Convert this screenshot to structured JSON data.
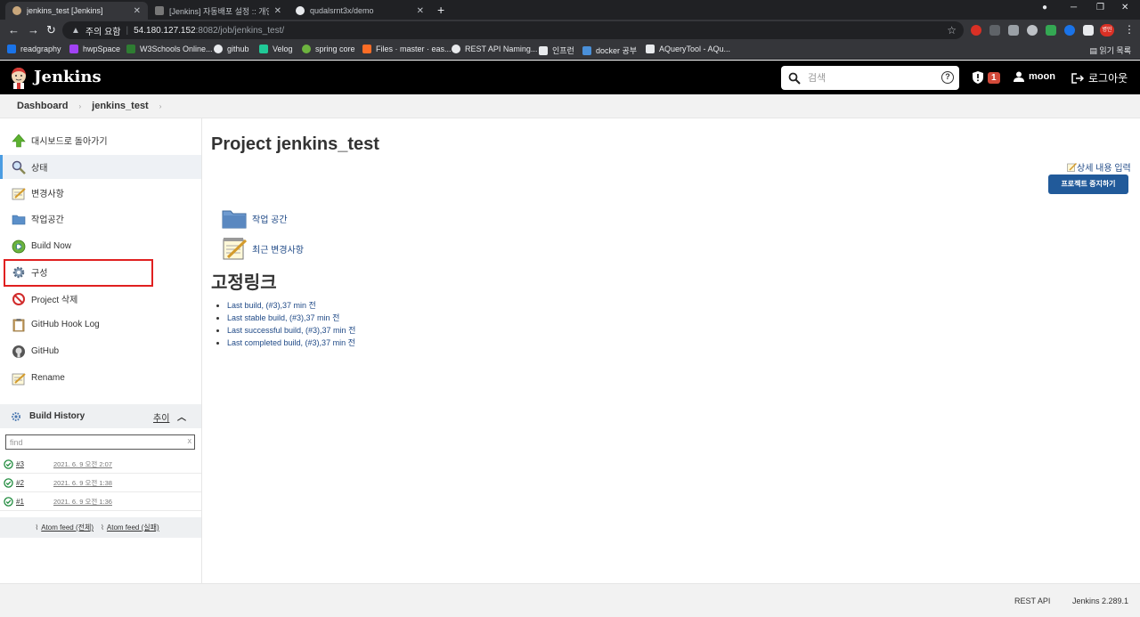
{
  "browser": {
    "tabs": [
      {
        "title": "jenkins_test [Jenkins]",
        "active": true
      },
      {
        "title": "[Jenkins] 자동배포 설정 :: 개인",
        "active": false
      },
      {
        "title": "qudalsrnt3x/demo",
        "active": false
      }
    ],
    "address": {
      "warning": "주의 요함",
      "host": "54.180.127.152",
      "path": ":8082/job/jenkins_test/"
    },
    "bookmarks": [
      "readgraphy",
      "hwpSpace",
      "W3Schools Online...",
      "github",
      "Velog",
      "spring core",
      "Files · master · eas...",
      "REST API Naming...",
      "인프런",
      "docker 공부",
      "AQueryTool - AQu..."
    ],
    "reading_list": "읽기 목록"
  },
  "header": {
    "brand": "Jenkins",
    "search_placeholder": "검색",
    "help": "?",
    "alert_count": "1",
    "user": "moon",
    "logout": "로그아웃"
  },
  "breadcrumb": [
    "Dashboard",
    "jenkins_test"
  ],
  "sidebar": {
    "tasks": [
      {
        "label": "대시보드로 돌아가기",
        "icon": "up-arrow-icon"
      },
      {
        "label": "상태",
        "icon": "search-icon"
      },
      {
        "label": "변경사항",
        "icon": "notepad-icon"
      },
      {
        "label": "작업공간",
        "icon": "folder-icon"
      },
      {
        "label": "Build Now",
        "icon": "build-icon"
      },
      {
        "label": "구성",
        "icon": "gear-icon"
      },
      {
        "label": "Project 삭제",
        "icon": "no-entry-icon"
      },
      {
        "label": "GitHub Hook Log",
        "icon": "clipboard-icon"
      },
      {
        "label": "GitHub",
        "icon": "github-icon"
      },
      {
        "label": "Rename",
        "icon": "notepad-icon"
      }
    ],
    "build_history": {
      "title": "Build History",
      "trend": "추이",
      "filter_placeholder": "find",
      "filter_clear": "x",
      "builds": [
        {
          "number": "#3",
          "date": "2021. 6. 9 오전 2:07"
        },
        {
          "number": "#2",
          "date": "2021. 6. 9 오전 1:38"
        },
        {
          "number": "#1",
          "date": "2021. 6. 9 오전 1:36"
        }
      ],
      "feed_all": "Atom feed (전체)",
      "feed_fail": "Atom feed (실패)"
    }
  },
  "main": {
    "title": "Project jenkins_test",
    "description_link": "상세 내용 입력",
    "disable_button": "프로젝트 중지하기",
    "links": [
      {
        "label": "작업 공간",
        "icon": "folder-icon"
      },
      {
        "label": "최근 변경사항",
        "icon": "notepad-icon"
      }
    ],
    "permalinks_title": "고정링크",
    "permalinks": [
      "Last build, (#3),37 min 전",
      "Last stable build, (#3),37 min 전",
      "Last successful build, (#3),37 min 전",
      "Last completed build, (#3),37 min 전"
    ]
  },
  "footer": {
    "rest_api": "REST API",
    "version": "Jenkins 2.289.1"
  },
  "colors": {
    "jenkins_header": "#000000",
    "link": "#204a87",
    "button": "#215a9a",
    "highlight_box": "#e02020",
    "selected_accent": "#4b9ce2"
  }
}
